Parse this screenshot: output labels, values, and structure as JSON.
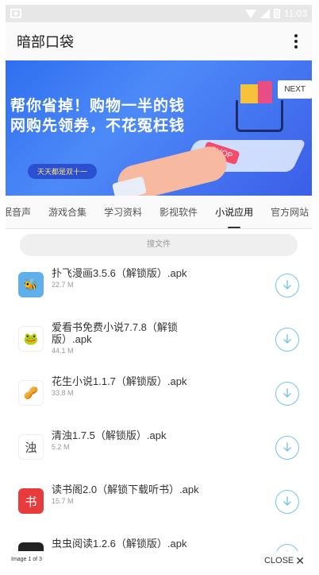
{
  "status_bar": {
    "time": "11:03"
  },
  "app": {
    "title": "暗部口袋"
  },
  "banner": {
    "line1": "帮你省掉！购物一半的钱",
    "line2": "网购先领券，不花冤枉钱",
    "pill": "天天都是双十一",
    "shop_label": "SHOP",
    "next_label": "NEXT"
  },
  "tabs": [
    "眠音声",
    "游戏合集",
    "学习资料",
    "影视软件",
    "小说应用",
    "官方网站"
  ],
  "active_tab": "小说应用",
  "search": {
    "placeholder": "搜文件"
  },
  "files": [
    {
      "name": "扑飞漫画3.5.6（解锁版）.apk",
      "size": "22.7 M",
      "icon": "bee-app-icon",
      "color": "#5fb0ea",
      "glyph": "🐝"
    },
    {
      "name": "爱看书免费小说7.7.8（解锁版）.apk",
      "size": "44.1 M",
      "icon": "frog-app-icon",
      "color": "#ffffff",
      "glyph": "🐸"
    },
    {
      "name": "花生小说1.1.7（解锁版）.apk",
      "size": "33.8 M",
      "icon": "peanut-app-icon",
      "color": "#ffffff",
      "glyph": "🥜"
    },
    {
      "name": "清浊1.7.5（解锁版）.apk",
      "size": "5.2 M",
      "icon": "qingzhuo-app-icon",
      "color": "#ffffff",
      "glyph": "浊"
    },
    {
      "name": "读书阁2.0（解锁下载听书）.apk",
      "size": "15.7 M",
      "icon": "book-app-icon",
      "color": "#e83b3b",
      "glyph": "书"
    },
    {
      "name": "虫虫阅读1.2.6（解锁版）.apk",
      "size": "",
      "icon": "bug-app-icon",
      "color": "#222222",
      "glyph": ""
    }
  ],
  "footer": {
    "image_count": "Image 1 of 3",
    "close_label": "CLOSE"
  }
}
